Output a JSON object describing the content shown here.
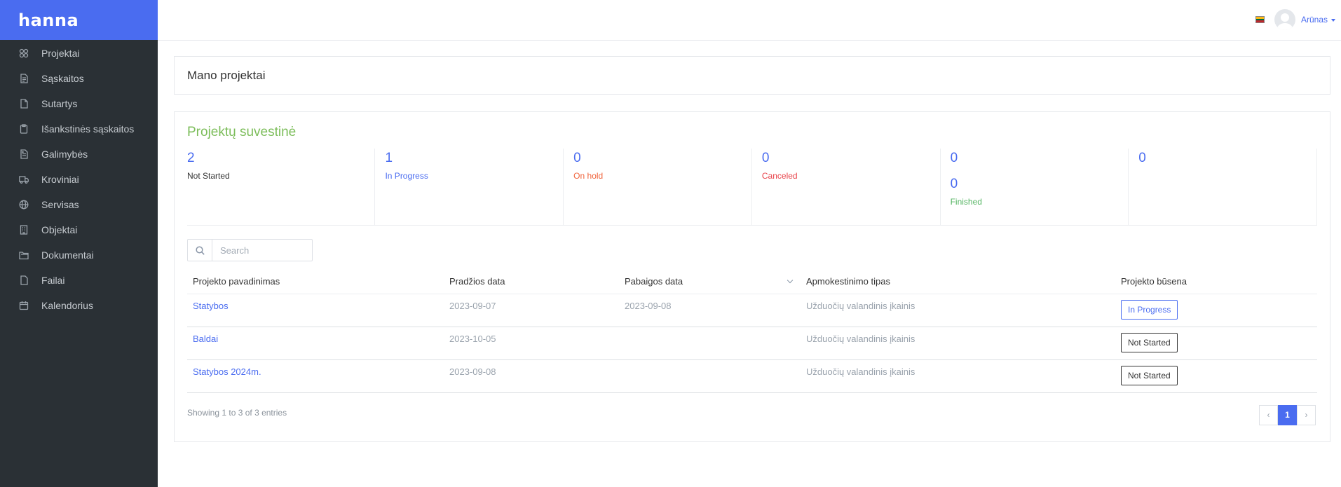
{
  "app": {
    "logo": "hanna"
  },
  "sidebar": {
    "items": [
      {
        "label": "Projektai",
        "icon": "projects-icon"
      },
      {
        "label": "Sąskaitos",
        "icon": "invoice-icon"
      },
      {
        "label": "Sutartys",
        "icon": "contract-icon"
      },
      {
        "label": "Išankstinės sąskaitos",
        "icon": "clipboard-icon"
      },
      {
        "label": "Galimybės",
        "icon": "opportunity-icon"
      },
      {
        "label": "Kroviniai",
        "icon": "truck-icon"
      },
      {
        "label": "Servisas",
        "icon": "globe-icon"
      },
      {
        "label": "Objektai",
        "icon": "building-icon"
      },
      {
        "label": "Dokumentai",
        "icon": "folder-icon"
      },
      {
        "label": "Failai",
        "icon": "file-icon"
      },
      {
        "label": "Kalendorius",
        "icon": "calendar-icon"
      }
    ]
  },
  "topbar": {
    "user": "Arūnas",
    "flag_colors": [
      "#fdb913",
      "#006a44",
      "#c1272d"
    ]
  },
  "page": {
    "title": "Mano projektai"
  },
  "summary": {
    "title": "Projektų suvestinė",
    "stats": [
      {
        "value": "2",
        "label": "Not Started",
        "color": "#333333"
      },
      {
        "value": "1",
        "label": "In Progress",
        "color": "#4a6cf0"
      },
      {
        "value": "0",
        "label": "On hold",
        "color": "#f0643c"
      },
      {
        "value": "0",
        "label": "Canceled",
        "color": "#e8434a"
      },
      {
        "value": "0",
        "label": "",
        "value2": "0",
        "label2": "Finished",
        "color": "#55b563"
      },
      {
        "value": "0",
        "label": ""
      }
    ]
  },
  "search": {
    "placeholder": "Search"
  },
  "table": {
    "columns": [
      "Projekto pavadinimas",
      "Pradžios data",
      "Pabaigos data",
      "Apmokestinimo tipas",
      "Projekto būsena"
    ],
    "rows": [
      {
        "name": "Statybos",
        "start": "2023-09-07",
        "end": "2023-09-08",
        "billing": "Užduočių valandinis įkainis",
        "status": "In Progress"
      },
      {
        "name": "Baldai",
        "start": "2023-10-05",
        "end": "",
        "billing": "Užduočių valandinis įkainis",
        "status": "Not Started"
      },
      {
        "name": "Statybos 2024m.",
        "start": "2023-09-08",
        "end": "",
        "billing": "Užduočių valandinis įkainis",
        "status": "Not Started"
      }
    ]
  },
  "footer": {
    "entries": "Showing 1 to 3 of 3 entries",
    "prev": "‹",
    "page": "1",
    "next": "›"
  }
}
